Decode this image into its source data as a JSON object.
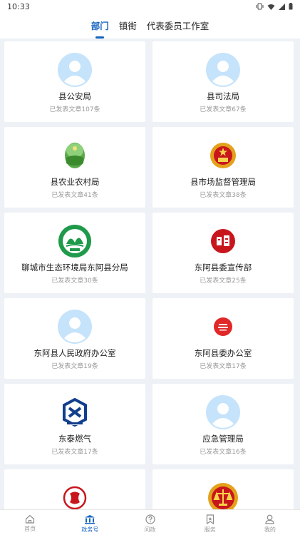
{
  "status_bar": {
    "time": "10:33"
  },
  "tabs": [
    {
      "label": "部门",
      "active": true
    },
    {
      "label": "镇街",
      "active": false
    },
    {
      "label": "代表委员工作室",
      "active": false
    }
  ],
  "departments": [
    {
      "name": "县公安局",
      "count": "已发表文章107条",
      "icon": "default-avatar-icon"
    },
    {
      "name": "县司法局",
      "count": "已发表文章67条",
      "icon": "default-avatar-icon"
    },
    {
      "name": "县农业农村局",
      "count": "已发表文章41条",
      "icon": "agriculture-logo-icon"
    },
    {
      "name": "县市场监督管理局",
      "count": "已发表文章38条",
      "icon": "national-emblem-icon"
    },
    {
      "name": "聊城市生态环境局东阿县分局",
      "count": "已发表文章30条",
      "icon": "environment-logo-icon"
    },
    {
      "name": "东阿县委宣传部",
      "count": "已发表文章25条",
      "icon": "propaganda-logo-icon"
    },
    {
      "name": "东阿县人民政府办公室",
      "count": "已发表文章19条",
      "icon": "default-avatar-icon"
    },
    {
      "name": "东阿县委办公室",
      "count": "已发表文章17条",
      "icon": "office-logo-icon"
    },
    {
      "name": "东泰燃气",
      "count": "已发表文章17条",
      "icon": "gas-company-logo-icon"
    },
    {
      "name": "应急管理局",
      "count": "已发表文章16条",
      "icon": "default-avatar-icon"
    },
    {
      "name": "",
      "count": "",
      "icon": "red-seal-logo-icon"
    },
    {
      "name": "",
      "count": "",
      "icon": "court-emblem-icon"
    }
  ],
  "bottom_nav": [
    {
      "label": "首页",
      "icon": "home-icon",
      "active": false
    },
    {
      "label": "政务号",
      "icon": "government-building-icon",
      "active": true
    },
    {
      "label": "问政",
      "icon": "question-icon",
      "active": false
    },
    {
      "label": "服务",
      "icon": "bookmark-icon",
      "active": false
    },
    {
      "label": "我的",
      "icon": "user-icon",
      "active": false
    }
  ],
  "colors": {
    "accent": "#1565c0",
    "avatar_bg": "#c5e3fb",
    "seal_red": "#c8161d",
    "page_bg": "#eef1f5"
  }
}
